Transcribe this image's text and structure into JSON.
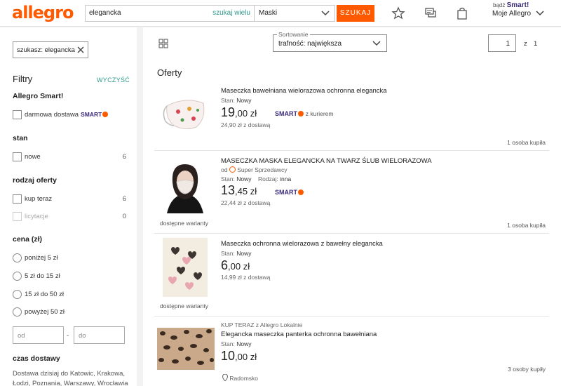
{
  "header": {
    "logo": "allegro",
    "search_value": "elegancka",
    "search_many": "szukaj wielu",
    "category": "Maski",
    "search_button": "SZUKAJ",
    "smart_prefix": "bądź",
    "smart_word": "Smart!",
    "account": "Moje Allegro"
  },
  "sidebar": {
    "chip_label": "szukasz: elegancka",
    "filters_title": "Filtry",
    "clear_label": "WYCZYŚĆ",
    "smart_title": "Allegro Smart!",
    "free_delivery": "darmowa dostawa",
    "smart_badge": "SMART",
    "stan_title": "stan",
    "stan_items": [
      {
        "label": "nowe",
        "count": "6"
      }
    ],
    "rodzaj_title": "rodzaj oferty",
    "rodzaj_items": [
      {
        "label": "kup teraz",
        "count": "6"
      },
      {
        "label": "licytacje",
        "count": "0"
      }
    ],
    "cena_title": "cena (zł)",
    "cena_items": [
      "poniżej 5 zł",
      "5 zł do 15 zł",
      "15 zł do 50 zł",
      "powyżej 50 zł"
    ],
    "price_from": "od",
    "price_to": "do",
    "price_dash": "-",
    "czas_title": "czas dostawy",
    "czas_desc": "Dostawa dzisiaj do Katowic, Krakowa, Łodzi, Poznania, Warszawy, Wrocławia"
  },
  "main": {
    "sort_legend": "Sortowanie",
    "sort_value": "trafność: największa",
    "page_current": "1",
    "page_of": "z",
    "page_total": "1",
    "section_title": "Oferty",
    "offers": [
      {
        "title": "Maseczka bawełniana wielorazowa ochronna elegancka",
        "condition_label": "Stan:",
        "condition": "Nowy",
        "price_int": "19",
        "price_dec": ",00 zł",
        "smart": "SMART",
        "smart_suffix": "z kurierem",
        "shipping": "24,90 zł z dostawą",
        "buyers": "1 osoba kupiła"
      },
      {
        "title": "MASECZKA MASKA ELEGANCKA NA TWARZ ŚLUB WIELORAZOWA",
        "seller_prefix": "od",
        "seller": "Super Sprzedawcy",
        "condition_label": "Stan:",
        "condition": "Nowy",
        "kind_label": "Rodzaj:",
        "kind": "inna",
        "price_int": "13",
        "price_dec": ",45 zł",
        "smart": "SMART",
        "shipping": "22,44 zł z dostawą",
        "variants": "dostępne warianty",
        "buyers": "1 osoba kupiła"
      },
      {
        "title": "Maseczka ochronna wielorazowa z bawełny elegancka",
        "condition_label": "Stan:",
        "condition": "Nowy",
        "price_int": "6",
        "price_dec": ",00 zł",
        "shipping": "14,99 zł z dostawą",
        "variants": "dostępne warianty"
      },
      {
        "source": "KUP TERAZ z Allegro Lokalnie",
        "title": "Elegancka maseczka panterka ochronna bawełniana",
        "condition_label": "Stan:",
        "condition": "Nowy",
        "price_int": "10",
        "price_dec": ",00 zł",
        "location": "Radomsko",
        "buyers": "3 osoby kupiły"
      }
    ]
  },
  "colors": {
    "brand": "#ff5a00",
    "accent": "#2e9a8b",
    "smart": "#3b2a7a"
  }
}
